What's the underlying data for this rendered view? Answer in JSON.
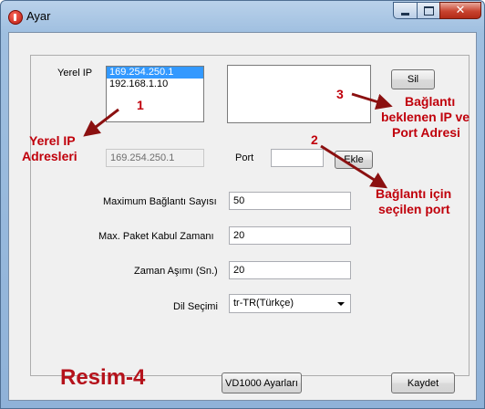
{
  "window": {
    "title": "Ayar"
  },
  "form": {
    "local_ip_label": "Yerel IP",
    "local_ip_list": [
      "169.254.250.1",
      "192.168.1.10"
    ],
    "selected_ip": "169.254.250.1",
    "sil_button": "Sil",
    "port_label": "Port",
    "port_value": "",
    "ekle_button": "Ekle",
    "max_connections_label": "Maximum Bağlantı Sayısı",
    "max_connections_value": "50",
    "max_packet_time_label": "Max. Paket Kabul Zamanı",
    "max_packet_time_value": "20",
    "timeout_label": "Zaman Aşımı (Sn.)",
    "timeout_value": "20",
    "language_label": "Dil Seçimi",
    "language_value": "tr-TR(Türkçe)"
  },
  "footer": {
    "vd_button": "VD1000 Ayarları",
    "save_button": "Kaydet"
  },
  "annotations": {
    "num1": "1",
    "num2": "2",
    "num3": "3",
    "local_ip_caption_line1": "Yerel IP",
    "local_ip_caption_line2": "Adresleri",
    "expected_caption_line1": "Bağlantı",
    "expected_caption_line2": "beklenen IP ve",
    "expected_caption_line3": "Port Adresi",
    "port_caption_line1": "Bağlantı için",
    "port_caption_line2": "seçilen port",
    "figure_label": "Resim-4"
  },
  "colors": {
    "annotation_red": "#c0000b",
    "arrow_dark_red": "#8b1010",
    "selection_blue": "#3399ff"
  }
}
